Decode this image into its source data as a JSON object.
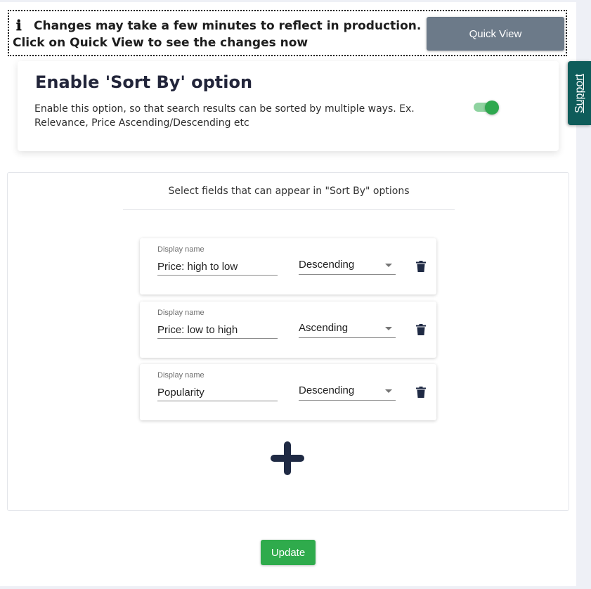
{
  "notice": {
    "message": "Changes may take a few minutes to reflect in production. Click on Quick View to see the changes now",
    "quick_view_label": "Quick View"
  },
  "support_tab": {
    "label": "Support"
  },
  "sort_by_card": {
    "title": "Enable 'Sort By' option",
    "description": "Enable this option, so that search results can be sorted by multiple ways. Ex. Relevance, Price Ascending/Descending etc",
    "enabled": true
  },
  "fields_panel": {
    "title": "Select fields that can appear in \"Sort By\" options",
    "fields": [
      {
        "display_name_label": "Display name",
        "display_name": "Price: high to low",
        "order": "Descending"
      },
      {
        "display_name_label": "Display name",
        "display_name": "Price: low to high",
        "order": "Ascending"
      },
      {
        "display_name_label": "Display name",
        "display_name": "Popularity",
        "order": "Descending"
      }
    ]
  },
  "icons": {
    "info": "info-icon",
    "toggle": "toggle-switch",
    "delete": "trash-icon",
    "add": "plus-icon"
  },
  "colors": {
    "quick_view_bg": "#6c7a89",
    "support_tab_bg": "#0e5c5a",
    "toggle_on": "#2fa84f",
    "update_bg": "#2fab4c",
    "icon_dark": "#1f2a44"
  },
  "update_button": {
    "label": "Update"
  }
}
